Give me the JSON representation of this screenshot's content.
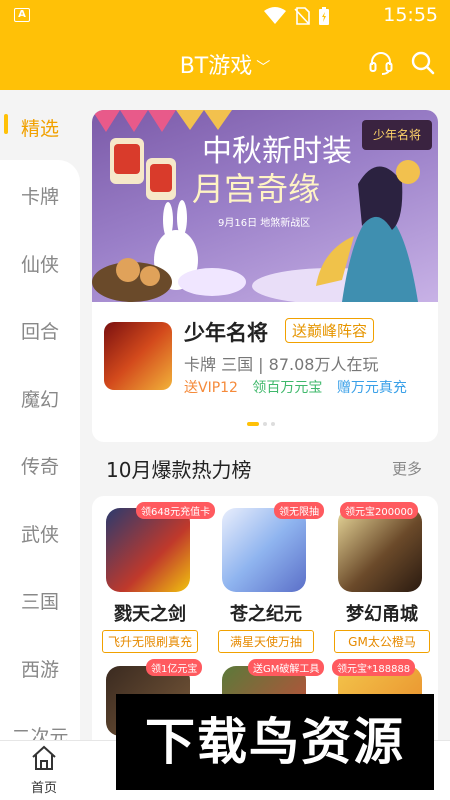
{
  "status": {
    "time": "15:55"
  },
  "header": {
    "title": "BT游戏",
    "chevron": "﹀"
  },
  "sidebar": {
    "active": "精选",
    "items": [
      "卡牌",
      "仙侠",
      "回合",
      "魔幻",
      "传奇",
      "武侠",
      "三国",
      "西游",
      "二次元"
    ]
  },
  "banner": {
    "title_line1": "中秋新时装",
    "title_line2": "月宫奇缘",
    "subtitle": "9月16日  地煞新战区",
    "logo": "少年名将"
  },
  "featured": {
    "name": "少年名将",
    "tag": "送巅峰阵容",
    "meta": "卡牌 三国 | 87.08万人在玩",
    "perks": [
      "送VIP12",
      "领百万元宝",
      "赠万元真充"
    ]
  },
  "section": {
    "title": "10月爆款热力榜",
    "more": "更多"
  },
  "ranking": [
    {
      "badge": "领648元充值卡",
      "name": "戮天之剑",
      "sub": "飞升无限刷真充"
    },
    {
      "badge": "领无限抽",
      "name": "苍之纪元",
      "sub": "满星天使万抽"
    },
    {
      "badge": "领元宝200000",
      "name": "梦幻甬城",
      "sub": "GM太公橙马"
    }
  ],
  "ranking_row2": [
    {
      "badge": "领1亿元宝"
    },
    {
      "badge": "送GM破解工具"
    },
    {
      "badge": "领元宝*188888"
    }
  ],
  "bottom": {
    "home": "首页"
  },
  "watermark": "下载鸟资源",
  "colors": {
    "accent": "#ffc107",
    "badge": "#ff5a5f"
  }
}
